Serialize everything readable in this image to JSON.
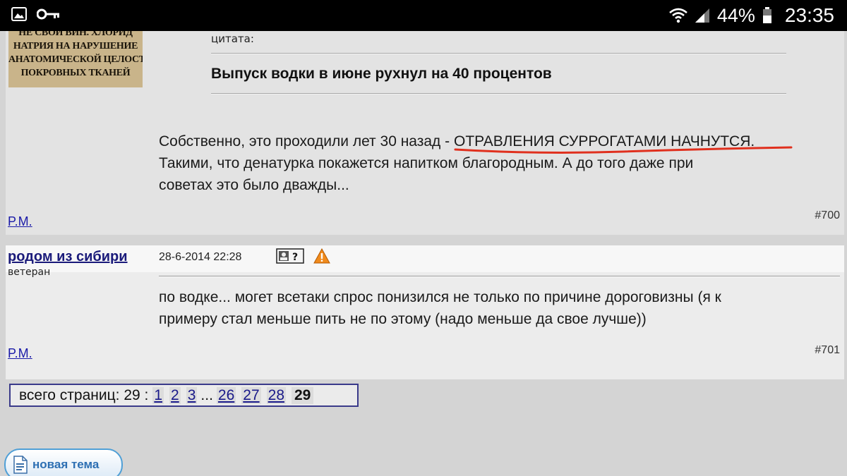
{
  "status_bar": {
    "battery_text": "44%",
    "time": "23:35"
  },
  "post_700": {
    "avatar_lines": [
      "НЕ СВОЙ ВИН. ХЛОРИД",
      "НАТРИЯ НА НАРУШЕНИЕ",
      "АНАТОМИЧЕСКОЙ ЦЕЛОСТНОСТИ",
      "ПОКРОВНЫХ ТКАНЕЙ"
    ],
    "quote_label": "цитата:",
    "quote_title": "Выпуск водки в июне рухнул на 40 процентов",
    "message_before": "Собственно, это проходили лет 30 назад - ",
    "message_underlined": "ОТРАВЛЕНИЯ СУРРОГАТАМИ НАЧНУТСЯ",
    "message_line1_end": ".",
    "message_line2": "Такими, что денатурка покажется напитком благородным. А до того даже при",
    "message_line3": "советах это было дважды...",
    "pm_link": "P.M.",
    "post_number": "#700"
  },
  "post_701": {
    "username": "родом из сибири",
    "rank": "ветеран",
    "date": "28-6-2014 22:28",
    "message_line1": "по водке... могет всетаки спрос понизился не только по причине дороговизны (я к",
    "message_line2": "примеру стал меньше пить не по этому (надо меньше да свое лучше))",
    "pm_link": "P.M.",
    "post_number": "#701"
  },
  "pager": {
    "label": "всего страниц: 29 :",
    "pages": [
      "1",
      "2",
      "3"
    ],
    "ellipsis": "...",
    "pages_end": [
      "26",
      "27",
      "28"
    ],
    "current": "29"
  },
  "new_topic_button": {
    "label": "новая тема"
  },
  "colors": {
    "link": "#1a1aa8",
    "underline_marker": "#e0301e",
    "button_accent": "#2d6fb3"
  }
}
